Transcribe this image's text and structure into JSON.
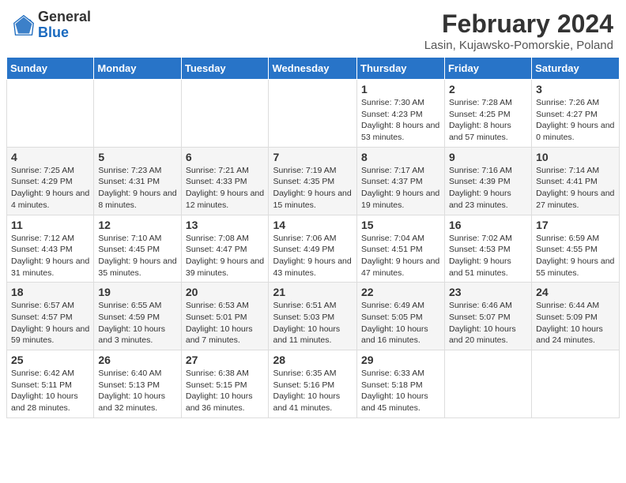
{
  "header": {
    "logo_general": "General",
    "logo_blue": "Blue",
    "month_title": "February 2024",
    "location": "Lasin, Kujawsko-Pomorskie, Poland"
  },
  "days_of_week": [
    "Sunday",
    "Monday",
    "Tuesday",
    "Wednesday",
    "Thursday",
    "Friday",
    "Saturday"
  ],
  "weeks": [
    [
      {
        "day": "",
        "info": ""
      },
      {
        "day": "",
        "info": ""
      },
      {
        "day": "",
        "info": ""
      },
      {
        "day": "",
        "info": ""
      },
      {
        "day": "1",
        "info": "Sunrise: 7:30 AM\nSunset: 4:23 PM\nDaylight: 8 hours and 53 minutes."
      },
      {
        "day": "2",
        "info": "Sunrise: 7:28 AM\nSunset: 4:25 PM\nDaylight: 8 hours and 57 minutes."
      },
      {
        "day": "3",
        "info": "Sunrise: 7:26 AM\nSunset: 4:27 PM\nDaylight: 9 hours and 0 minutes."
      }
    ],
    [
      {
        "day": "4",
        "info": "Sunrise: 7:25 AM\nSunset: 4:29 PM\nDaylight: 9 hours and 4 minutes."
      },
      {
        "day": "5",
        "info": "Sunrise: 7:23 AM\nSunset: 4:31 PM\nDaylight: 9 hours and 8 minutes."
      },
      {
        "day": "6",
        "info": "Sunrise: 7:21 AM\nSunset: 4:33 PM\nDaylight: 9 hours and 12 minutes."
      },
      {
        "day": "7",
        "info": "Sunrise: 7:19 AM\nSunset: 4:35 PM\nDaylight: 9 hours and 15 minutes."
      },
      {
        "day": "8",
        "info": "Sunrise: 7:17 AM\nSunset: 4:37 PM\nDaylight: 9 hours and 19 minutes."
      },
      {
        "day": "9",
        "info": "Sunrise: 7:16 AM\nSunset: 4:39 PM\nDaylight: 9 hours and 23 minutes."
      },
      {
        "day": "10",
        "info": "Sunrise: 7:14 AM\nSunset: 4:41 PM\nDaylight: 9 hours and 27 minutes."
      }
    ],
    [
      {
        "day": "11",
        "info": "Sunrise: 7:12 AM\nSunset: 4:43 PM\nDaylight: 9 hours and 31 minutes."
      },
      {
        "day": "12",
        "info": "Sunrise: 7:10 AM\nSunset: 4:45 PM\nDaylight: 9 hours and 35 minutes."
      },
      {
        "day": "13",
        "info": "Sunrise: 7:08 AM\nSunset: 4:47 PM\nDaylight: 9 hours and 39 minutes."
      },
      {
        "day": "14",
        "info": "Sunrise: 7:06 AM\nSunset: 4:49 PM\nDaylight: 9 hours and 43 minutes."
      },
      {
        "day": "15",
        "info": "Sunrise: 7:04 AM\nSunset: 4:51 PM\nDaylight: 9 hours and 47 minutes."
      },
      {
        "day": "16",
        "info": "Sunrise: 7:02 AM\nSunset: 4:53 PM\nDaylight: 9 hours and 51 minutes."
      },
      {
        "day": "17",
        "info": "Sunrise: 6:59 AM\nSunset: 4:55 PM\nDaylight: 9 hours and 55 minutes."
      }
    ],
    [
      {
        "day": "18",
        "info": "Sunrise: 6:57 AM\nSunset: 4:57 PM\nDaylight: 9 hours and 59 minutes."
      },
      {
        "day": "19",
        "info": "Sunrise: 6:55 AM\nSunset: 4:59 PM\nDaylight: 10 hours and 3 minutes."
      },
      {
        "day": "20",
        "info": "Sunrise: 6:53 AM\nSunset: 5:01 PM\nDaylight: 10 hours and 7 minutes."
      },
      {
        "day": "21",
        "info": "Sunrise: 6:51 AM\nSunset: 5:03 PM\nDaylight: 10 hours and 11 minutes."
      },
      {
        "day": "22",
        "info": "Sunrise: 6:49 AM\nSunset: 5:05 PM\nDaylight: 10 hours and 16 minutes."
      },
      {
        "day": "23",
        "info": "Sunrise: 6:46 AM\nSunset: 5:07 PM\nDaylight: 10 hours and 20 minutes."
      },
      {
        "day": "24",
        "info": "Sunrise: 6:44 AM\nSunset: 5:09 PM\nDaylight: 10 hours and 24 minutes."
      }
    ],
    [
      {
        "day": "25",
        "info": "Sunrise: 6:42 AM\nSunset: 5:11 PM\nDaylight: 10 hours and 28 minutes."
      },
      {
        "day": "26",
        "info": "Sunrise: 6:40 AM\nSunset: 5:13 PM\nDaylight: 10 hours and 32 minutes."
      },
      {
        "day": "27",
        "info": "Sunrise: 6:38 AM\nSunset: 5:15 PM\nDaylight: 10 hours and 36 minutes."
      },
      {
        "day": "28",
        "info": "Sunrise: 6:35 AM\nSunset: 5:16 PM\nDaylight: 10 hours and 41 minutes."
      },
      {
        "day": "29",
        "info": "Sunrise: 6:33 AM\nSunset: 5:18 PM\nDaylight: 10 hours and 45 minutes."
      },
      {
        "day": "",
        "info": ""
      },
      {
        "day": "",
        "info": ""
      }
    ]
  ]
}
